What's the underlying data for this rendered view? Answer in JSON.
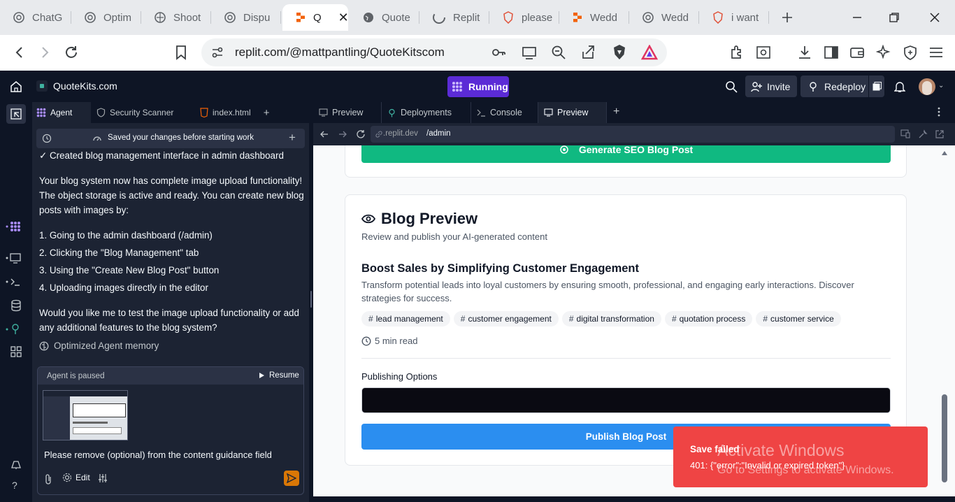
{
  "browser": {
    "tabs": [
      {
        "label": "ChatG",
        "icon": "chatgpt-icon"
      },
      {
        "label": "Optim",
        "icon": "chatgpt-icon"
      },
      {
        "label": "Shoot",
        "icon": "globe-icon"
      },
      {
        "label": "Dispu",
        "icon": "chatgpt-icon"
      },
      {
        "label": "Q",
        "icon": "replit-icon",
        "active": true
      },
      {
        "label": "Quote",
        "icon": "globe-icon"
      },
      {
        "label": "Replit",
        "icon": "loading-icon"
      },
      {
        "label": "please",
        "icon": "brave-icon"
      },
      {
        "label": "Wedd",
        "icon": "replit-icon"
      },
      {
        "label": "Wedd",
        "icon": "globe-icon"
      },
      {
        "label": "i want",
        "icon": "brave-icon"
      }
    ],
    "url": "replit.com/@mattpantling/QuoteKitscom"
  },
  "replit": {
    "project_name": "QuoteKits.com",
    "run_status": "Running",
    "invite_label": "Invite",
    "redeploy_label": "Redeploy",
    "agent_tabs": [
      "Agent",
      "Security Scanner",
      "index.html"
    ],
    "checkpoint_text": "Saved your changes before starting work",
    "chat": {
      "line1": "✓ Created blog management interface in admin dashboard",
      "para1": "Your blog system now has complete image upload functionality! The object storage is active and ready. You can create new blog posts with images by:",
      "steps": [
        "1. Going to the admin dashboard (/admin)",
        "2. Clicking the \"Blog Management\" tab",
        "3. Using the \"Create New Blog Post\" button",
        "4. Uploading images directly in the editor"
      ],
      "para2": "Would you like me to test the image upload functionality or add any additional features to the blog system?",
      "memory_note": "Optimized Agent memory"
    },
    "input": {
      "paused_label": "Agent is paused",
      "resume_label": "Resume",
      "message": "Please remove (optional) from the content guidance field",
      "edit_label": "Edit"
    },
    "preview_tabs": [
      "Preview",
      "Deployments",
      "Console",
      "Preview"
    ],
    "preview_url_prefix": ".replit.dev",
    "preview_url_path": "/admin"
  },
  "page": {
    "generate_button": "Generate SEO Blog Post",
    "blog_preview_title": "Blog Preview",
    "blog_preview_subtitle": "Review and publish your AI-generated content",
    "post_title": "Boost Sales by Simplifying Customer Engagement",
    "post_excerpt": "Transform potential leads into loyal customers by ensuring smooth, professional, and engaging early interactions. Discover strategies for success.",
    "tags": [
      "lead management",
      "customer engagement",
      "digital transformation",
      "quotation process",
      "customer service"
    ],
    "read_time": "5 min read",
    "publishing_options_label": "Publishing Options",
    "publish_button": "Publish Blog Post"
  },
  "toast": {
    "title": "Save failed",
    "message": "401: {\"error\":\"Invalid or expired token\"}"
  },
  "watermark": {
    "line1": "Activate Windows",
    "line2": "Go to Settings to activate Windows."
  },
  "colors": {
    "accent_green": "#10b981",
    "publish_blue": "#2b8ef0",
    "toast_red": "#ef4444",
    "running_purple": "#5b2bd6"
  }
}
